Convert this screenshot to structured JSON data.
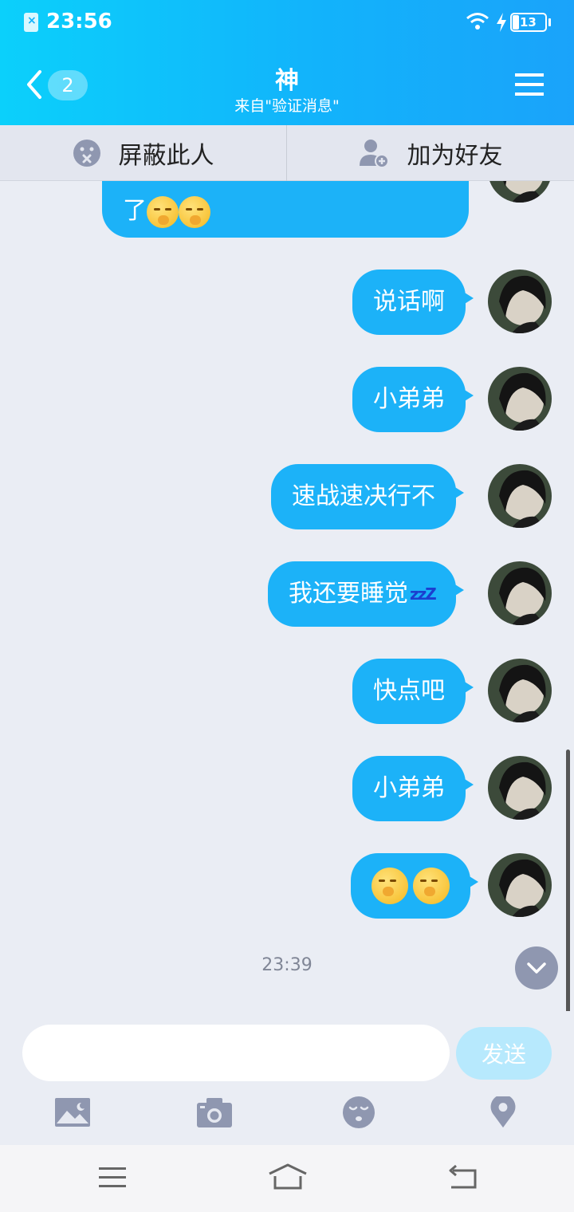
{
  "status_bar": {
    "time": "23:56",
    "battery": "13"
  },
  "header": {
    "back_count": "2",
    "title": "神",
    "subtitle": "来自\"验证消息\""
  },
  "actions": {
    "block_label": "屏蔽此人",
    "add_friend_label": "加为好友"
  },
  "messages": [
    {
      "type": "received",
      "text": "了"
    },
    {
      "type": "sent",
      "text": "说话啊"
    },
    {
      "type": "sent",
      "text": "小弟弟"
    },
    {
      "type": "sent",
      "text": "速战速决行不"
    },
    {
      "type": "sent",
      "text": "我还要睡觉",
      "suffix": "zzZ"
    },
    {
      "type": "sent",
      "text": "快点吧"
    },
    {
      "type": "sent",
      "text": "小弟弟"
    },
    {
      "type": "sent",
      "text": ""
    }
  ],
  "timestamp": "23:39",
  "input": {
    "value": "",
    "placeholder": "",
    "send_label": "发送"
  },
  "colors": {
    "header_start": "#0bd0fb",
    "header_end": "#1aa3fa",
    "bubble": "#1cb2f8",
    "send_disabled": "#b7e9fd"
  },
  "icons": {
    "toolbar": [
      "image-icon",
      "camera-icon",
      "emoji-icon",
      "location-icon"
    ],
    "nav": [
      "menu-icon",
      "home-icon",
      "back-icon"
    ]
  }
}
